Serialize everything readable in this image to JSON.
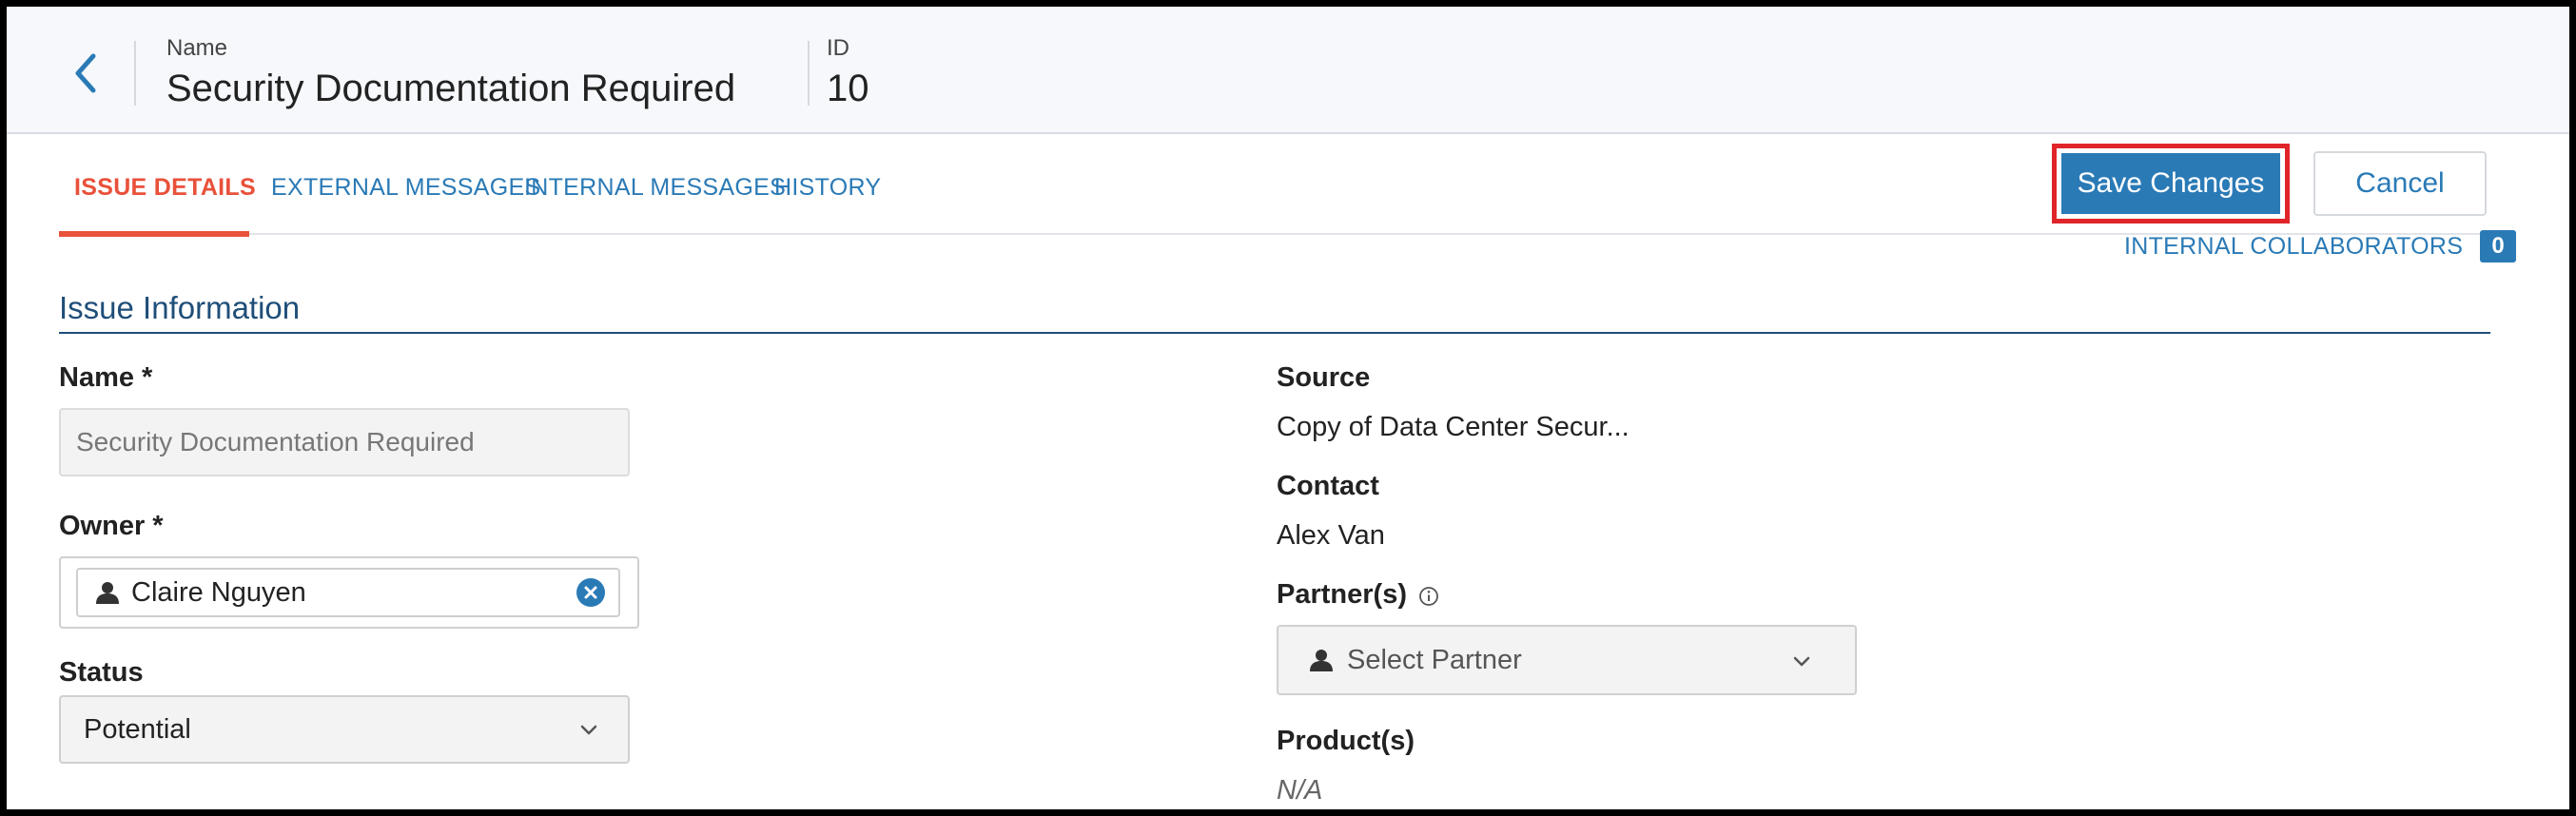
{
  "header": {
    "name_label": "Name",
    "name_value": "Security Documentation Required",
    "id_label": "ID",
    "id_value": "10"
  },
  "tabs": [
    {
      "label": "ISSUE DETAILS",
      "active": true
    },
    {
      "label": "EXTERNAL MESSAGES",
      "active": false
    },
    {
      "label": "INTERNAL MESSAGES",
      "active": false
    },
    {
      "label": "HISTORY",
      "active": false
    }
  ],
  "actions": {
    "save_label": "Save Changes",
    "cancel_label": "Cancel"
  },
  "collaborators": {
    "label": "INTERNAL COLLABORATORS",
    "count": "0"
  },
  "section": {
    "title": "Issue Information"
  },
  "form": {
    "name": {
      "label": "Name *",
      "value": "Security Documentation Required"
    },
    "owner": {
      "label": "Owner *",
      "value": "Claire Nguyen"
    },
    "status": {
      "label": "Status",
      "value": "Potential"
    },
    "source": {
      "label": "Source",
      "value": "Copy of Data Center Secur..."
    },
    "contact": {
      "label": "Contact",
      "value": "Alex Van"
    },
    "partners": {
      "label": "Partner(s)",
      "placeholder": "Select Partner"
    },
    "products": {
      "label": "Product(s)",
      "value": "N/A"
    }
  },
  "colors": {
    "accent_blue": "#2a7ab6",
    "active_tab": "#e9513a",
    "highlight_red": "#e0252a",
    "section_navy": "#1f4e79"
  }
}
